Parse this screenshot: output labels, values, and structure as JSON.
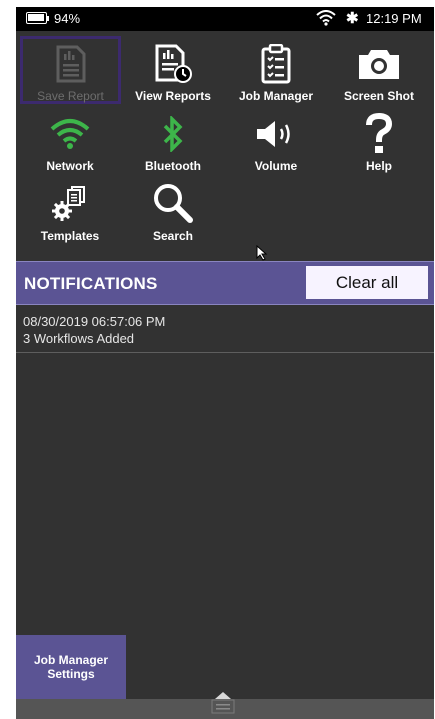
{
  "status_bar": {
    "battery": "94%",
    "time": "12:19 PM"
  },
  "toolbar": {
    "items": [
      {
        "label": "Save Report",
        "icon": "save-report-icon",
        "enabled": false
      },
      {
        "label": "View Reports",
        "icon": "view-reports-icon",
        "enabled": true
      },
      {
        "label": "Job Manager",
        "icon": "job-manager-icon",
        "enabled": true
      },
      {
        "label": "Screen Shot",
        "icon": "camera-icon",
        "enabled": true
      },
      {
        "label": "Network",
        "icon": "wifi-icon",
        "enabled": true
      },
      {
        "label": "Bluetooth",
        "icon": "bluetooth-icon",
        "enabled": true
      },
      {
        "label": "Volume",
        "icon": "volume-icon",
        "enabled": true
      },
      {
        "label": "Help",
        "icon": "help-icon",
        "enabled": true
      },
      {
        "label": "Templates",
        "icon": "templates-icon",
        "enabled": true
      },
      {
        "label": "Search",
        "icon": "search-icon",
        "enabled": true
      }
    ]
  },
  "notifications": {
    "title": "NOTIFICATIONS",
    "clear_label": "Clear all",
    "items": [
      {
        "timestamp": "08/30/2019 06:57:06 PM",
        "message": "3 Workflows Added"
      }
    ]
  },
  "job_manager_settings": {
    "line1": "Job Manager",
    "line2": "Settings"
  },
  "colors": {
    "accent": "#5b5494",
    "background": "#323232",
    "network_green": "#3db54a"
  }
}
